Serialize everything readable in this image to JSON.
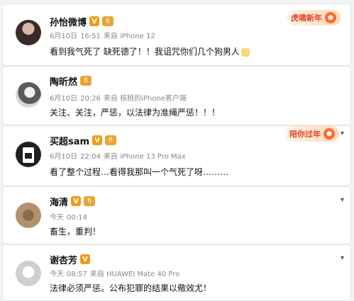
{
  "comments": [
    {
      "name": "孙怡微博",
      "date": "6月10日",
      "time": "16:51",
      "source": "来自 iPhone 12",
      "text": "看到我气死了 缺死德了！！我诅咒你们几个狗男人",
      "vip_mark": "V",
      "level_mark": "6",
      "deco_text": "虎啸新年"
    },
    {
      "name": "陶昕然",
      "date": "6月10日",
      "time": "20:26",
      "source": "来自 核桃的iPhone客户端",
      "text": "关注、关注，严惩，以法律为准绳严惩！！！",
      "level_mark": "6"
    },
    {
      "name": "买超sam",
      "date": "6月10日",
      "time": "22:04",
      "source": "来自 iPhone 13 Pro Max",
      "text": "看了整个过程…看得我那叫一个气死了呀………",
      "vip_mark": "V",
      "level_mark": "6",
      "deco_text": "陪你过年"
    },
    {
      "name": "海清",
      "date": "今天",
      "time": "00:14",
      "source": "",
      "text": "畜生，重判！",
      "vip_mark": "V",
      "level_mark": "6"
    },
    {
      "name": "谢杏芳",
      "date": "今天",
      "time": "08:57",
      "source": "来自 HUAWEI Mate 40 Pro",
      "text": "法律必须严惩。公布犯罪的结果以儆效尤！",
      "vip_mark": "V"
    }
  ],
  "icons": {
    "more": "chevron-down-icon"
  },
  "colors": {
    "vip": "#f29b15",
    "deco": "#e0452a",
    "meta": "#888888"
  }
}
